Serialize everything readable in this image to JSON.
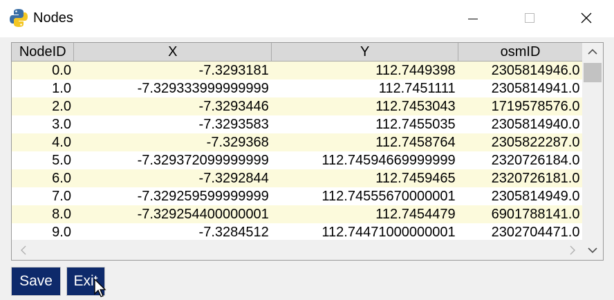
{
  "window": {
    "title": "Nodes",
    "icon": "python-icon",
    "controls": [
      "minimize-icon",
      "maximize-icon",
      "close-icon"
    ]
  },
  "table": {
    "columns": [
      "NodeID",
      "X",
      "Y",
      "osmID"
    ],
    "rows": [
      [
        "0.0",
        "-7.3293181",
        "112.7449398",
        "2305814946.0"
      ],
      [
        "1.0",
        "-7.329333999999999",
        "112.7451111",
        "2305814941.0"
      ],
      [
        "2.0",
        "-7.3293446",
        "112.7453043",
        "1719578576.0"
      ],
      [
        "3.0",
        "-7.3293583",
        "112.7455035",
        "2305814940.0"
      ],
      [
        "4.0",
        "-7.329368",
        "112.7458764",
        "2305822287.0"
      ],
      [
        "5.0",
        "-7.329372099999999",
        "112.74594669999999",
        "2320726184.0"
      ],
      [
        "6.0",
        "-7.3292844",
        "112.7459465",
        "2320726181.0"
      ],
      [
        "7.0",
        "-7.329259599999999",
        "112.74555670000001",
        "2305814949.0"
      ],
      [
        "8.0",
        "-7.329254400000001",
        "112.7454479",
        "6901788141.0"
      ],
      [
        "9.0",
        "-7.3284512",
        "112.74471000000001",
        "2302704471.0"
      ]
    ],
    "row_colors": [
      "#fcfadc",
      "#ffffff"
    ]
  },
  "buttons": {
    "save_label": "Save",
    "exit_label": "Exit"
  },
  "colors": {
    "button_bg": "#0e2a6b",
    "header_bg": "#d9d9d9"
  }
}
